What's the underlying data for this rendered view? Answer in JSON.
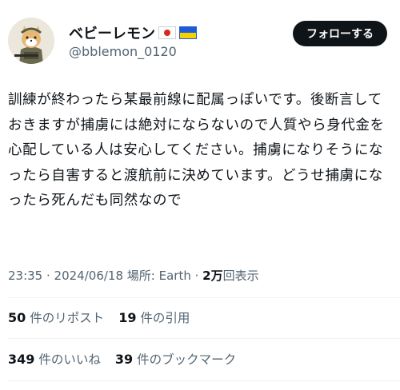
{
  "user": {
    "display_name": "ベビーレモン",
    "handle": "@bblemon_0120",
    "flags": [
      "japan-flag",
      "ukraine-flag"
    ]
  },
  "actions": {
    "follow_label": "フォローする"
  },
  "tweet": {
    "text": "訓練が終わったら某最前線に配属っぽいです。後断言しておきますが捕虜には絶対にならないので人質やら身代金を心配している人は安心してください。捕虜になりそうになったら自害すると渡航前に決めています。どうせ捕虜になったら死んだも同然なので"
  },
  "meta": {
    "time": "23:35",
    "separator1": " · ",
    "date": "2024/06/18",
    "location": " 場所: Earth",
    "separator2": " · ",
    "views_count": "2万",
    "views_label": "回表示"
  },
  "stats": {
    "reposts_count": "50",
    "reposts_label": "件のリポスト",
    "quotes_count": "19",
    "quotes_label": "件の引用",
    "likes_count": "349",
    "likes_label": "件のいいね",
    "bookmarks_count": "39",
    "bookmarks_label": "件のブックマーク"
  },
  "colors": {
    "text": "#0f1419",
    "secondary": "#536471",
    "button": "#0f1419",
    "divider": "#eff3f4"
  }
}
